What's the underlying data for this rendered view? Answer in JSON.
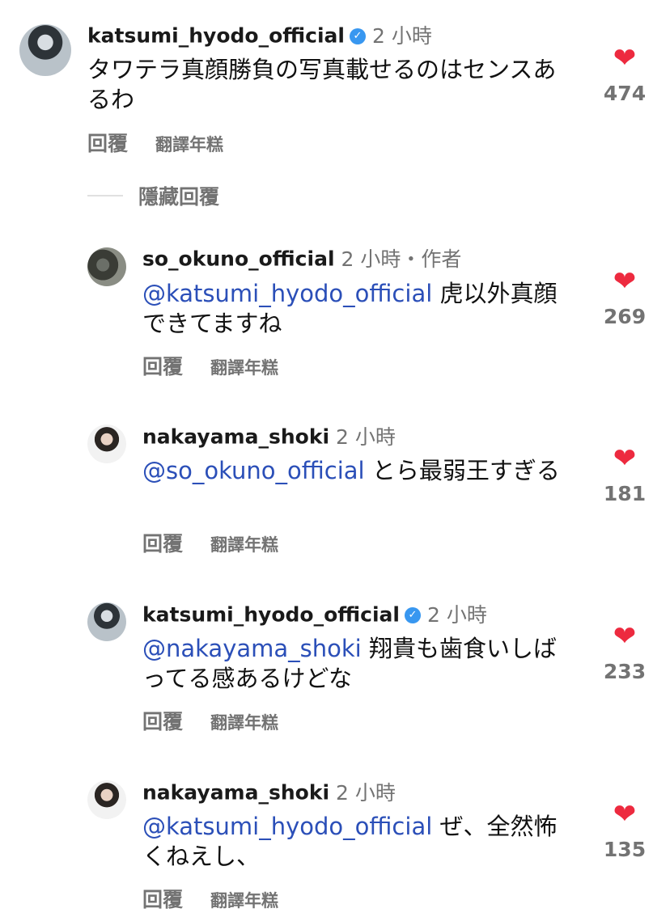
{
  "comments": [
    {
      "username": "katsumi_hyodo_official",
      "verified": true,
      "time": "2 小時",
      "mention": "",
      "text": "タワテラ真顔勝負の写真載せるのはセンスあるわ",
      "likes": "474",
      "reply_label": "回覆",
      "translate_label": "翻譯年糕"
    },
    {
      "username": "so_okuno_official",
      "verified": false,
      "time": "2 小時・作者",
      "mention": "@katsumi_hyodo_official",
      "text": " 虎以外真顔できてますね",
      "likes": "269",
      "reply_label": "回覆",
      "translate_label": "翻譯年糕"
    },
    {
      "username": "nakayama_shoki",
      "verified": false,
      "time": "2 小時",
      "mention": "@so_okuno_official",
      "text": " とら最弱王すぎる",
      "likes": "181",
      "reply_label": "回覆",
      "translate_label": "翻譯年糕"
    },
    {
      "username": "katsumi_hyodo_official",
      "verified": true,
      "time": "2 小時",
      "mention": "@nakayama_shoki",
      "text": " 翔貴も歯食いしばってる感あるけどな",
      "likes": "233",
      "reply_label": "回覆",
      "translate_label": "翻譯年糕"
    },
    {
      "username": "nakayama_shoki",
      "verified": false,
      "time": "2 小時",
      "mention": "@katsumi_hyodo_official",
      "text": " ぜ、全然怖くねえし、",
      "likes": "135",
      "reply_label": "回覆",
      "translate_label": "翻譯年糕"
    }
  ],
  "hide_replies_label": "隱藏回覆",
  "icons": {
    "like": "heart-icon",
    "verified": "verified-badge-icon"
  },
  "colors": {
    "heart": "#ed2a3f",
    "mention": "#2b4fb8",
    "verified": "#3897f0",
    "muted": "#737373"
  }
}
